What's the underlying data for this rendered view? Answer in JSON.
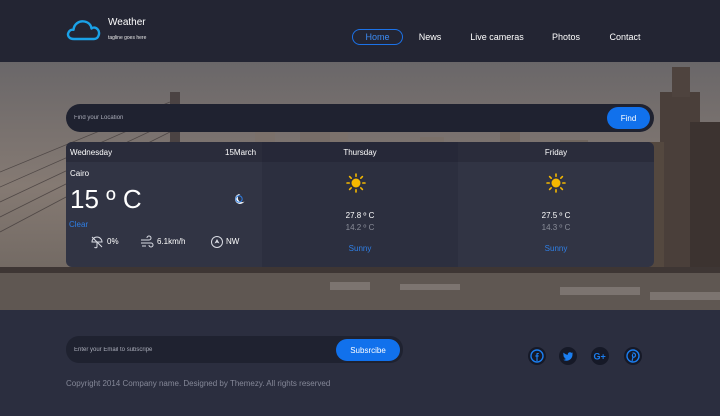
{
  "brand": {
    "title": "Weather",
    "tagline": "tagline goes here",
    "logo_icon": "cloud-icon"
  },
  "nav": {
    "items": [
      {
        "label": "Home",
        "active": true
      },
      {
        "label": "News",
        "active": false
      },
      {
        "label": "Live cameras",
        "active": false
      },
      {
        "label": "Photos",
        "active": false
      },
      {
        "label": "Contact",
        "active": false
      }
    ]
  },
  "search": {
    "placeholder": "Find your Location",
    "value": "",
    "button_label": "Find"
  },
  "forecast": {
    "today": {
      "day": "Wednesday",
      "date": "15March",
      "city": "Cairo",
      "temperature": "15 º C",
      "condition": "Clear",
      "condition_icon": "moon-icon",
      "rain": "0%",
      "wind_speed": "6.1km/h",
      "wind_direction": "NW",
      "rain_icon": "umbrella-icon",
      "wind_icon": "wind-icon",
      "compass_icon": "compass-icon"
    },
    "next_days": [
      {
        "day": "Thursday",
        "high": "27.8 º C",
        "low": "14.2 º C",
        "condition": "Sunny",
        "icon": "sun-icon"
      },
      {
        "day": "Friday",
        "high": "27.5 º C",
        "low": "14.3 º C",
        "condition": "Sunny",
        "icon": "sun-icon"
      }
    ]
  },
  "subscribe": {
    "placeholder": "Enter your Email to subscripe",
    "value": "",
    "button_label": "Subsrcibe"
  },
  "social": [
    {
      "name": "facebook-icon"
    },
    {
      "name": "twitter-icon"
    },
    {
      "name": "google-plus-icon"
    },
    {
      "name": "pinterest-icon"
    }
  ],
  "footer": {
    "copyright": "Copyright 2014 Company name. Designed by Themezy. All rights reserved"
  },
  "colors": {
    "accent": "#1171ec",
    "header_bg": "#232533",
    "footer_bg": "#2b2e3f",
    "sun": "#f5b800"
  }
}
